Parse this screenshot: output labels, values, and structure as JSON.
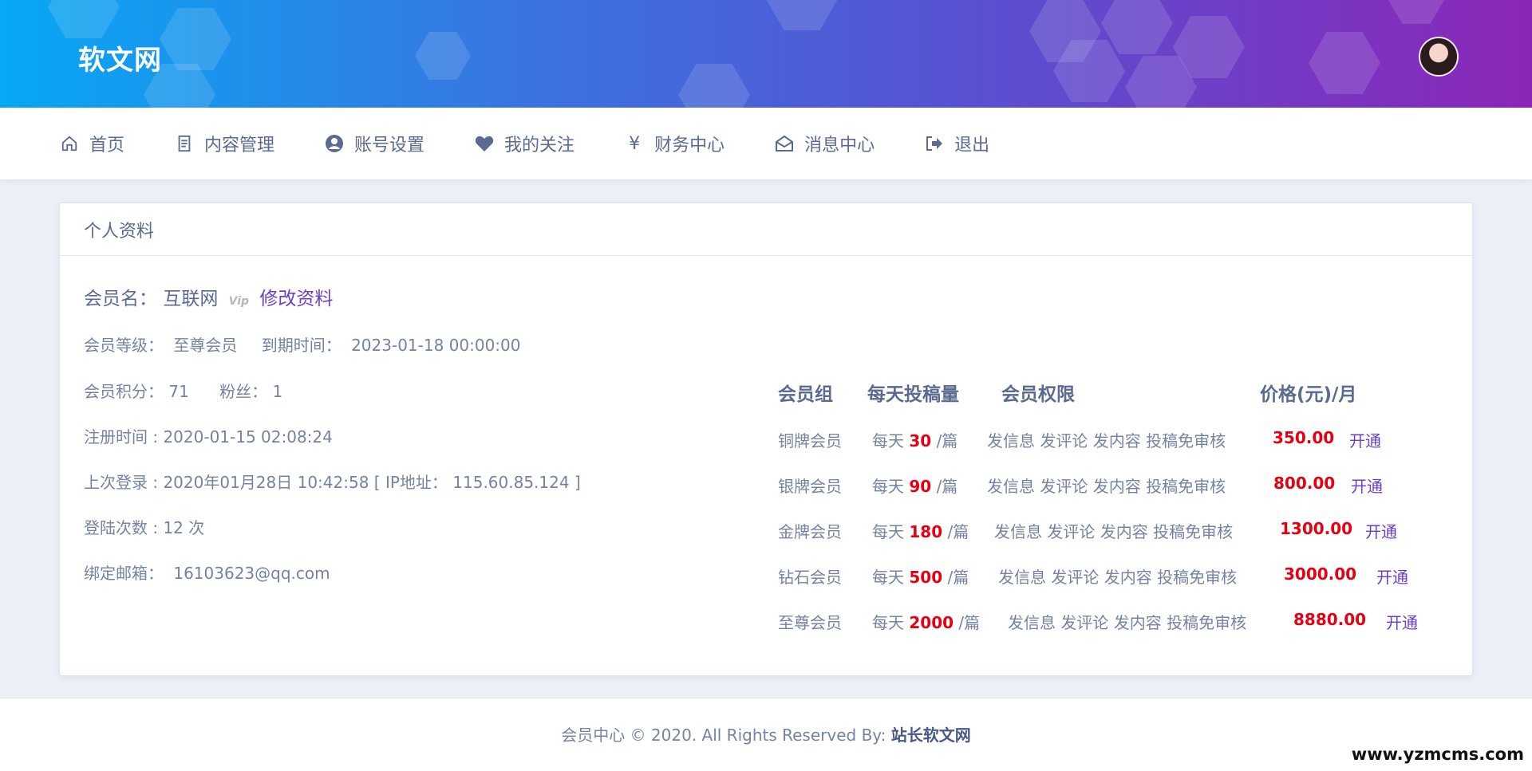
{
  "header": {
    "brand": "软文网"
  },
  "nav": [
    {
      "label": "首页",
      "icon": "home-icon"
    },
    {
      "label": "内容管理",
      "icon": "document-icon"
    },
    {
      "label": "账号设置",
      "icon": "user-circle-icon"
    },
    {
      "label": "我的关注",
      "icon": "heart-icon"
    },
    {
      "label": "财务中心",
      "icon": "yen-icon"
    },
    {
      "label": "消息中心",
      "icon": "envelope-icon"
    },
    {
      "label": "退出",
      "icon": "logout-icon"
    }
  ],
  "profile": {
    "title": "个人资料",
    "member_name_label": "会员名：",
    "member_name": "互联网",
    "vip": "Vip",
    "edit_label": "修改资料",
    "level_label": "会员等级：",
    "level": "至尊会员",
    "expire_label": "到期时间：",
    "expire": "2023-01-18 00:00:00",
    "points_label": "会员积分：",
    "points": "71",
    "fans_label": "粉丝：",
    "fans": "1",
    "register": "注册时间 : 2020-01-15 02:08:24",
    "last_login": "上次登录 : 2020年01月28日 10:42:58 [ IP地址：  115.60.85.124 ]",
    "login_count": "登陆次数 : 12 次",
    "email_label": "绑定邮箱：",
    "email": "16103623@qq.com"
  },
  "membership": {
    "headers": [
      "会员组",
      "每天投稿量",
      "会员权限",
      "价格(元)/月"
    ],
    "rows": [
      {
        "group": "铜牌会员",
        "daily_prefix": "每天",
        "daily": "30",
        "daily_suffix": "/篇",
        "rights": "发信息 发评论 发内容 投稿免审核",
        "price": "350.00",
        "action": "开通"
      },
      {
        "group": "银牌会员",
        "daily_prefix": "每天",
        "daily": "90",
        "daily_suffix": "/篇",
        "rights": "发信息 发评论 发内容 投稿免审核",
        "price": "800.00",
        "action": "开通"
      },
      {
        "group": "金牌会员",
        "daily_prefix": "每天",
        "daily": "180",
        "daily_suffix": "/篇",
        "rights": "发信息 发评论 发内容 投稿免审核",
        "price": "1300.00",
        "action": "开通"
      },
      {
        "group": "钻石会员",
        "daily_prefix": "每天",
        "daily": "500",
        "daily_suffix": "/篇",
        "rights": "发信息 发评论 发内容 投稿免审核",
        "price": "3000.00",
        "action": "开通"
      },
      {
        "group": "至尊会员",
        "daily_prefix": "每天",
        "daily": "2000",
        "daily_suffix": "/篇",
        "rights": "发信息 发评论 发内容 投稿免审核",
        "price": "8880.00",
        "action": "开通"
      }
    ]
  },
  "footer": {
    "copyright": "会员中心 © 2020. All Rights Reserved By:",
    "author": "站长软文网",
    "watermark": "www.yzmcms.com"
  },
  "colors": {
    "accent": "#6b3fc9",
    "price": "#e60012",
    "text": "#7583a3"
  }
}
